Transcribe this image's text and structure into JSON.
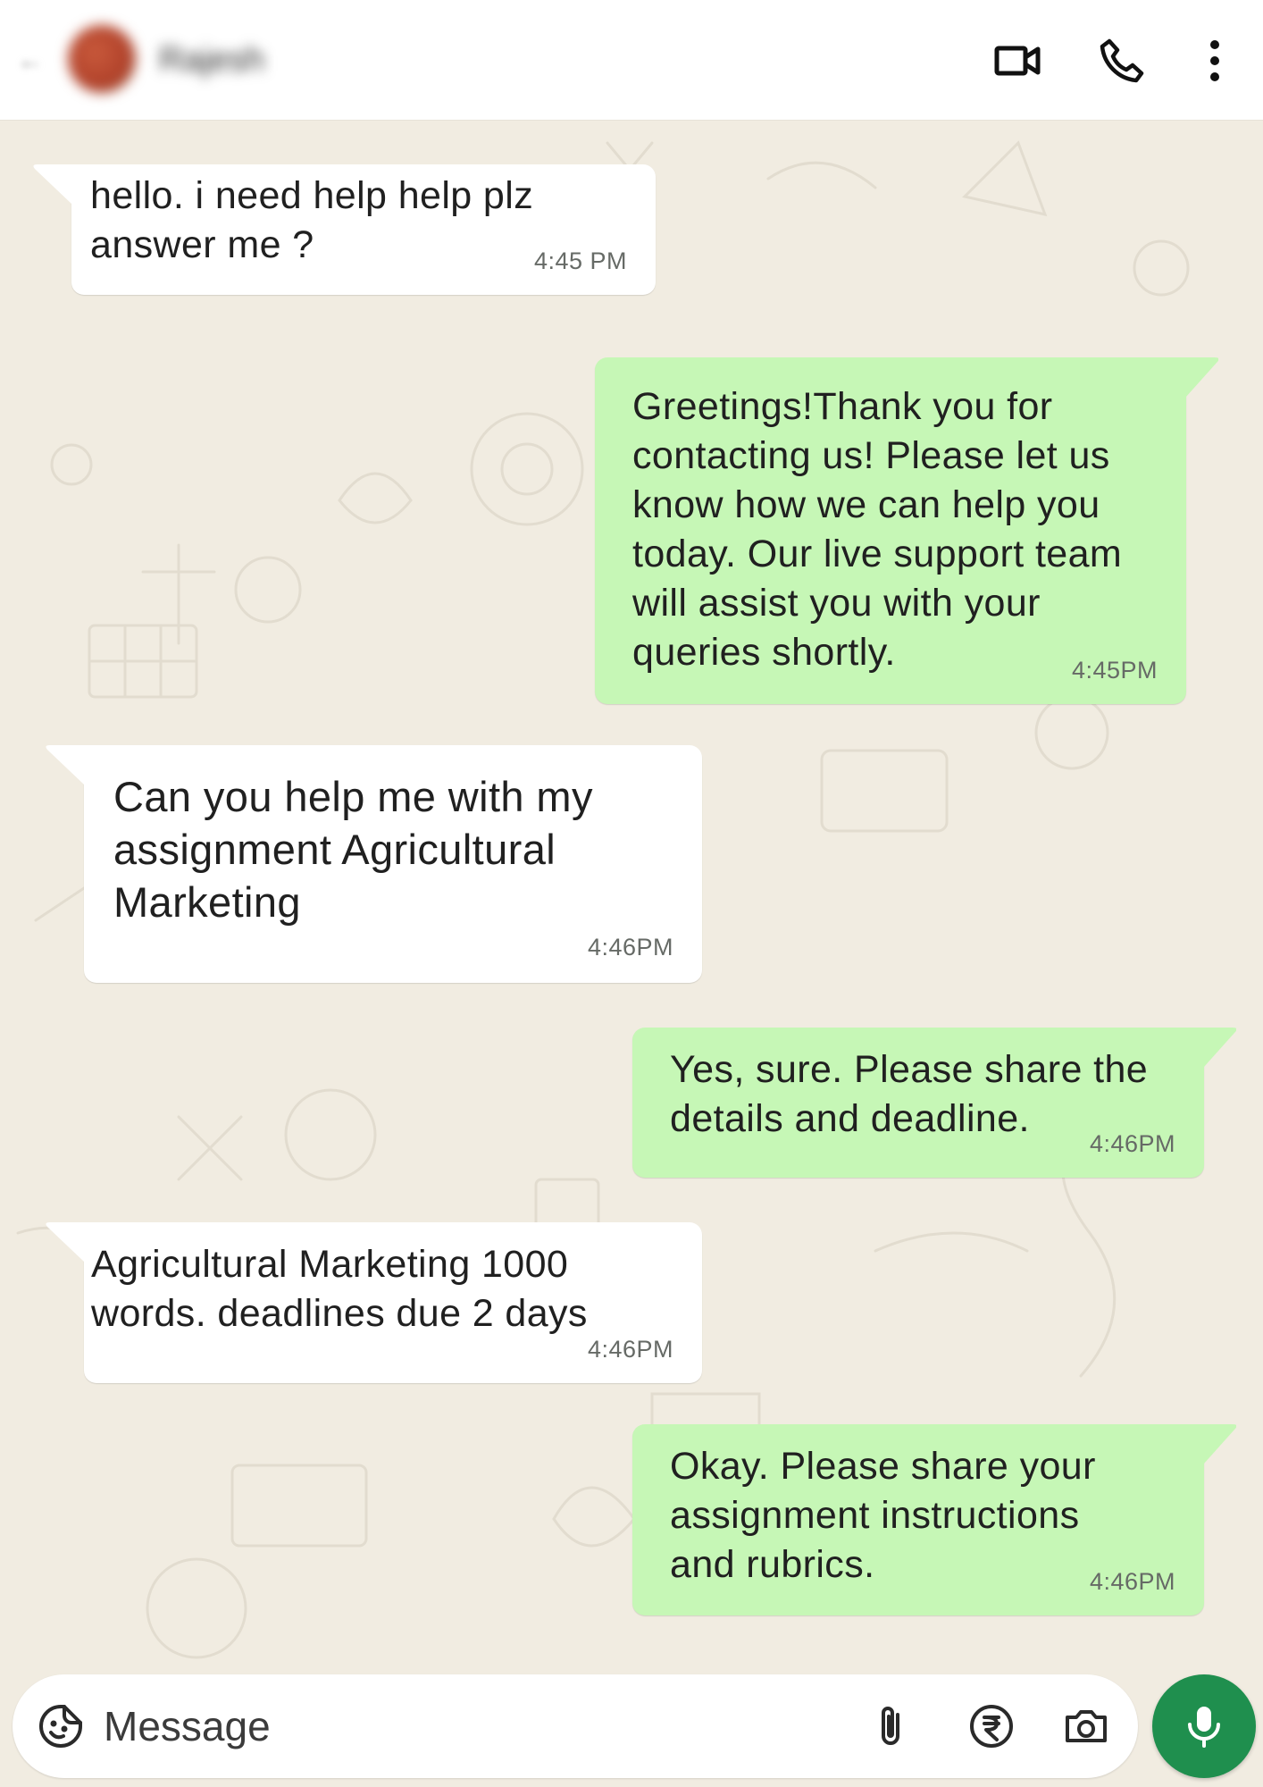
{
  "header": {
    "contact_name": "Rajesh",
    "icons": [
      "back-arrow-icon",
      "avatar",
      "video-call-icon",
      "voice-call-icon",
      "more-options-icon"
    ]
  },
  "messages": [
    {
      "direction": "incoming",
      "text": "hello. i need help help plz\nanswer me ?",
      "time": "4:45 PM"
    },
    {
      "direction": "outgoing",
      "text": "Greetings!Thank you for\ncontacting us! Please let us\nknow how we can help you\ntoday. Our live support team\nwill assist you with your\nqueries shortly.",
      "time": "4:45PM"
    },
    {
      "direction": "incoming",
      "text": "Can you help me with my\nassignment Agricultural\nMarketing",
      "time": "4:46PM"
    },
    {
      "direction": "outgoing",
      "text": "Yes, sure. Please share the\ndetails and deadline.",
      "time": "4:46PM"
    },
    {
      "direction": "incoming",
      "text": "Agricultural Marketing  1000\nwords. deadlines due 2 days",
      "time": "4:46PM"
    },
    {
      "direction": "outgoing",
      "text": "Okay. Please share your\nassignment instructions\nand rubrics.",
      "time": "4:46PM"
    }
  ],
  "composer": {
    "placeholder": "Message",
    "value": "",
    "icons": [
      "emoji-sticker-icon",
      "attach-icon",
      "payment-rupee-icon",
      "camera-icon",
      "mic-icon"
    ]
  },
  "colors": {
    "header_bg": "#ffffff",
    "chat_bg": "#f1ece1",
    "incoming_bubble": "#ffffff",
    "outgoing_bubble": "#c6f7b6",
    "mic_button": "#1f8f4e",
    "text": "#202020",
    "timestamp": "#666a66"
  }
}
